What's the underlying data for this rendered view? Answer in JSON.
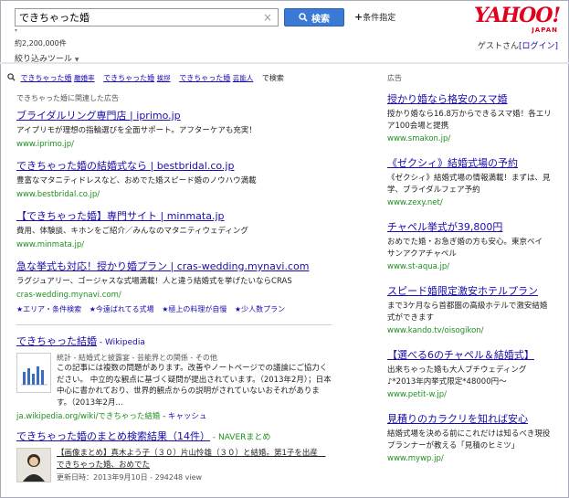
{
  "search": {
    "query": "できちゃった婚",
    "button_label": "検索",
    "conditions_label": "条件指定",
    "clear_icon": "×",
    "dropdown_icon": "▾"
  },
  "logo": {
    "text": "YAHOO!",
    "sub": "JAPAN"
  },
  "result_count": "約2,200,000件",
  "user": {
    "guest": "ゲスト",
    "suffix": "さん",
    "login": "[ログイン]"
  },
  "narrow": {
    "label": "絞り込みツール"
  },
  "related": {
    "items": [
      {
        "q": "できちゃった婚",
        "sub": "離婚率"
      },
      {
        "q": "できちゃった婚",
        "sub": "挨拶"
      },
      {
        "q": "できちゃった婚",
        "sub": "芸能人"
      }
    ],
    "suffix": "で検索"
  },
  "left": {
    "ads_label": "できちゃった婚に関連した広告",
    "ads": [
      {
        "title": "ブライダルリング専門店 | iprimo.jp",
        "desc": "アイプリモが理想の指輪選びを全面サポート。アフターケアも充実！",
        "url": "www.iprimo.jp/"
      },
      {
        "title": "できちゃった婚の結婚式なら | bestbridal.co.jp",
        "desc": "豊富なマタニティドレスなど、おめでた婚スピード婚のノウハウ満載",
        "url": "www.bestbridal.co.jp/"
      },
      {
        "title": "【できちゃった婚】専門サイト | minmata.jp",
        "desc": "費用、体験談、キホンをご紹介／みんなのマタニティウェディング",
        "url": "www.minmata.jp/"
      },
      {
        "title": "急な挙式も対応！授かり婚プラン | cras-wedding.mynavi.com",
        "desc": "ラグジュアリー、ゴージャスな式場満載！人と違う結婚式を挙げたいならCRAS",
        "url": "cras-wedding.mynavi.com/",
        "sitelinks": [
          "★エリア・条件検索",
          "★今遠ばれてる式場",
          "★極上の料理が自慢",
          "★少人数プラン"
        ]
      }
    ],
    "results": [
      {
        "title": "できちゃった結婚",
        "source": " - Wikipedia",
        "meta": "統計 - 結婚式と披露宴 - 芸能界との関係 - その他",
        "desc": "この記事には複数の問題があります。改善やノートページでの議論にご協力ください。 中立的な観点に基づく疑問が提出されています。（2013年2月）；日本中心に書かれており、世界的観点からの説明がされていないおそれがあります。（2013年2月...",
        "url": "ja.wikipedia.org/wiki/できちゃった結婚",
        "cache": "キャッシュ"
      },
      {
        "title": "できちゃった婚のまとめ検索結果（14件）",
        "source": " - NAVERまとめ",
        "desc": "【画像まとめ】真木よう子（３０）片山怜雄（３０）と結婚。第1子を出産　できちゃった婚、おめでた",
        "updated": "更新日時：2013年9月10日 - 294248 view"
      }
    ]
  },
  "right": {
    "ads_label": "広告",
    "ads": [
      {
        "title": "授かり婚なら格安のスマ婚",
        "desc": "授かり婚なら16.8万からできるスマ婚！各エリア100会場と提携",
        "url": "www.smakon.jp/"
      },
      {
        "title": "《ゼクシィ》結婚式場の予約",
        "desc": "《ゼクシィ》結婚式場の情報満載！まずは、見学、ブライダルフェア予約",
        "url": "www.zexy.net/"
      },
      {
        "title": "チャペル挙式が39,800円",
        "desc": "おめでた婚・お急ぎ婚の方も安心。東京ベイ サンアクアチャペル",
        "url": "www.st-aqua.jp/"
      },
      {
        "title": "スピード婚限定激安ホテルプラン",
        "desc": "まで3ケ月なら首都圏の高級ホテルで激安結婚式ができます",
        "url": "www.kando.tv/oisogikon/"
      },
      {
        "title": "【選べる6のチャペル＆結婚式】",
        "desc": "出来ちゃった婚も大人プチウェディング♪*2013年内挙式限定*48000円〜",
        "url": "www.petit-w.jp/"
      },
      {
        "title": "見積りのカラクリを知れば安心",
        "desc": "結婚式場を決める前にこれだけは知るべき現役プランナーが教える「見積のヒミツ」",
        "url": "www.mywp.jp/"
      }
    ]
  }
}
